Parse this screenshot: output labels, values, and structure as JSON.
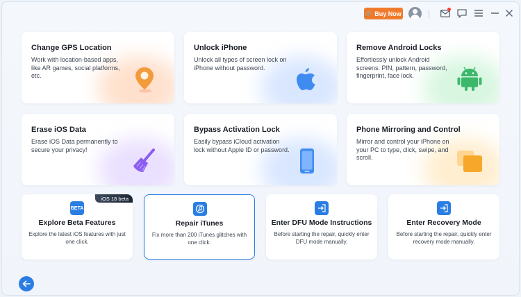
{
  "topbar": {
    "buy_label": "Buy Now",
    "icons": [
      "cart-icon",
      "user-avatar-icon",
      "mail-icon",
      "chat-icon",
      "menu-icon",
      "minimize-icon",
      "close-icon"
    ]
  },
  "cards": [
    {
      "title": "Change GPS Location",
      "desc": "Work with location-based apps, like AR games, social platforms, etc."
    },
    {
      "title": "Unlock iPhone",
      "desc": "Unlock all types of screen lock on iPhone without password."
    },
    {
      "title": "Remove Android Locks",
      "desc": "Effortlessly unlock Android screens: PIN, pattern, password, fingerprint, face lock."
    },
    {
      "title": "Erase iOS Data",
      "desc": "Erase iOS Data permanently to secure your privacy!"
    },
    {
      "title": "Bypass Activation Lock",
      "desc": "Easily bypass iCloud activation lock without Apple ID or password."
    },
    {
      "title": "Phone Mirroring and Control",
      "desc": "Mirror and control your iPhone on your PC to type, click, swipe, and scroll."
    }
  ],
  "small_cards": [
    {
      "title": "Explore Beta Features",
      "desc": "Explore the latest iOS features with just one click.",
      "badge": "iOS 18 beta",
      "icon_text": "BETA"
    },
    {
      "title": "Repair iTunes",
      "desc": "Fix more than 200 iTunes glitches with one click."
    },
    {
      "title": "Enter DFU Mode Instructions",
      "desc": "Before starting the repair, quickly enter DFU mode manually."
    },
    {
      "title": "Enter Recovery Mode",
      "desc": "Before starting the repair, quickly enter recovery mode manually."
    }
  ],
  "colors": {
    "accent": "#2a7ee3",
    "buy": "#f07a2c"
  }
}
